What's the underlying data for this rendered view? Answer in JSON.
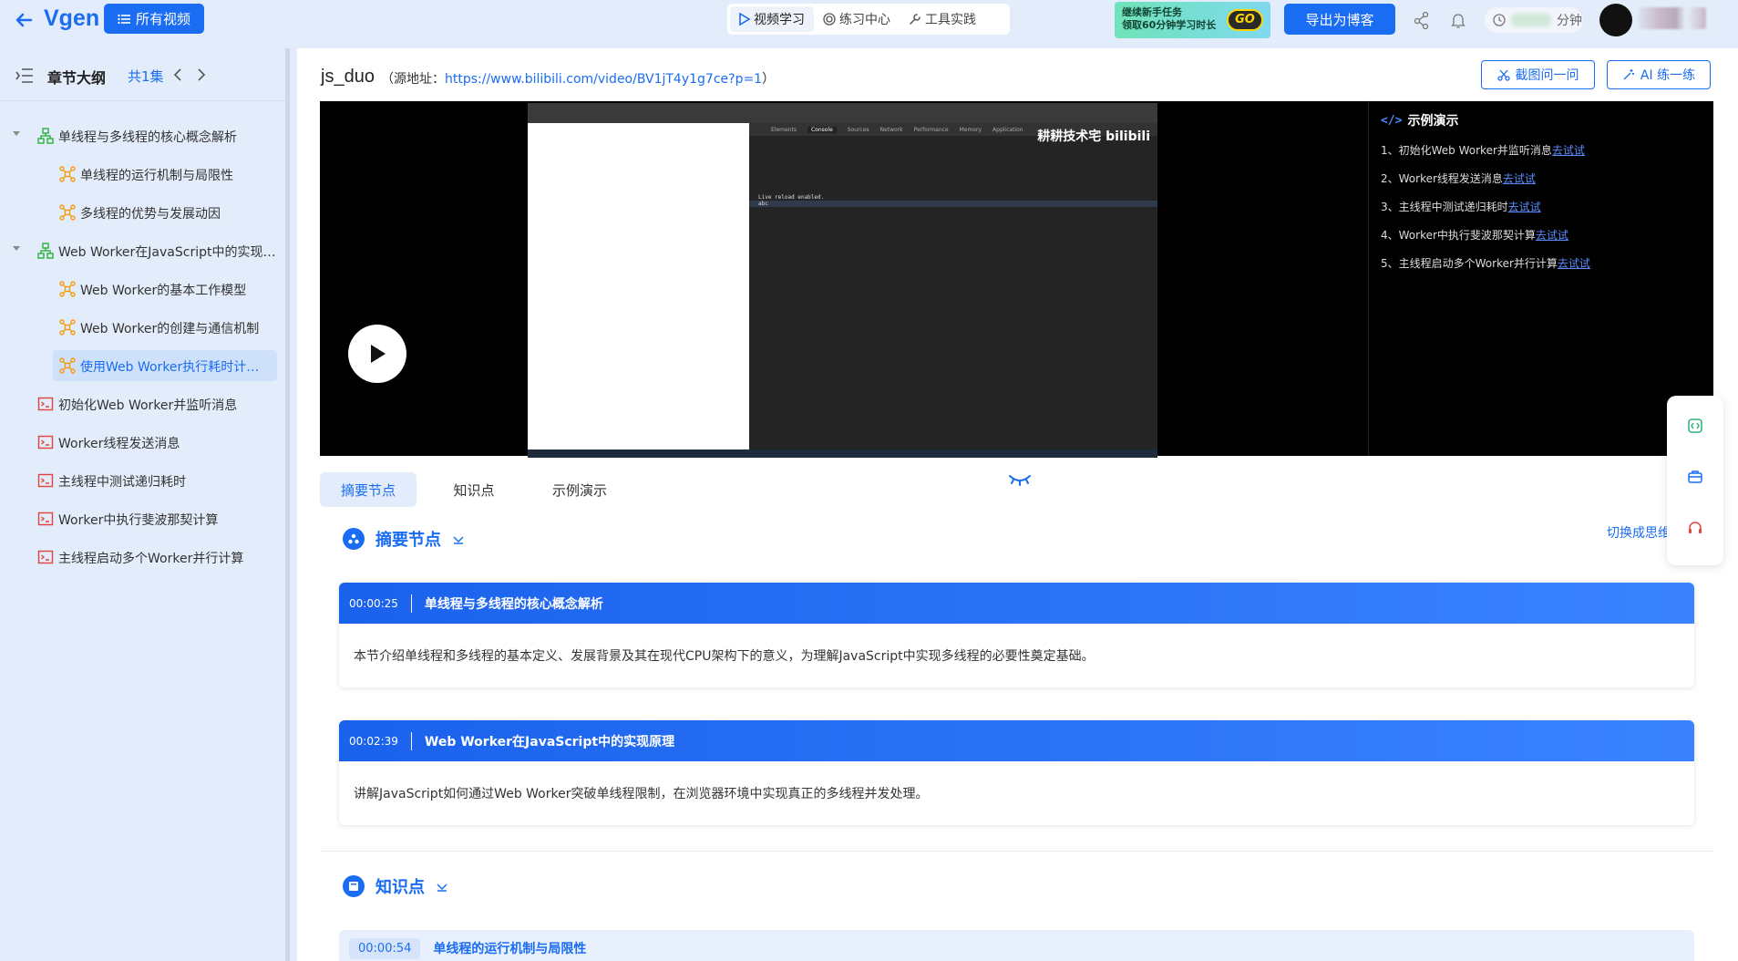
{
  "header": {
    "logo": "Vgen",
    "all_videos_label": "所有视频",
    "mode_tabs": [
      {
        "label": "视频学习",
        "icon": "play-outline-icon",
        "active": true
      },
      {
        "label": "练习中心",
        "icon": "target-icon",
        "active": false
      },
      {
        "label": "工具实践",
        "icon": "wrench-icon",
        "active": false
      }
    ],
    "promo_line1": "继续新手任务",
    "promo_line2": "领取60分钟学习时长",
    "promo_go": "GO",
    "export_label": "导出为博客",
    "timer_unit": "分钟"
  },
  "sidebar": {
    "title": "章节大纲",
    "count": "共1集",
    "items": [
      {
        "label": "单线程与多线程的核心概念解析",
        "level": 0,
        "type": "chapter",
        "expanded": true
      },
      {
        "label": "单线程的运行机制与局限性",
        "level": 1,
        "type": "point"
      },
      {
        "label": "多线程的优势与发展动因",
        "level": 1,
        "type": "point"
      },
      {
        "label": "Web Worker在JavaScript中的实现原...",
        "level": 0,
        "type": "chapter",
        "expanded": true
      },
      {
        "label": "Web Worker的基本工作模型",
        "level": 1,
        "type": "point"
      },
      {
        "label": "Web Worker的创建与通信机制",
        "level": 1,
        "type": "point"
      },
      {
        "label": "使用Web Worker执行耗时计算...",
        "level": 1,
        "type": "point",
        "active": true
      },
      {
        "label": "初始化Web Worker并监听消息",
        "level": 0,
        "type": "demo"
      },
      {
        "label": "Worker线程发送消息",
        "level": 0,
        "type": "demo"
      },
      {
        "label": "主线程中测试递归耗时",
        "level": 0,
        "type": "demo"
      },
      {
        "label": "Worker中执行斐波那契计算",
        "level": 0,
        "type": "demo"
      },
      {
        "label": "主线程启动多个Worker并行计算",
        "level": 0,
        "type": "demo"
      }
    ]
  },
  "main": {
    "title": "js_duo",
    "source_prefix": "（源地址：",
    "source_url": "https://www.bilibili.com/video/BV1jT4y1g7ce?p=1",
    "source_suffix": "）",
    "screenshot_ask_label": "截图问一问",
    "ai_practice_label": "AI 练一练",
    "player": {
      "watermark": "耕耕技术宅 bilibili",
      "devtools_tabs": [
        "Elements",
        "Console",
        "Sources",
        "Network",
        "Performance",
        "Memory",
        "Application"
      ],
      "console_lines": [
        "Live reload enabled.",
        "abc"
      ],
      "demo_title": "示例演示",
      "demo_items": [
        {
          "text": "1、初始化Web Worker并监听消息",
          "link": "去试试"
        },
        {
          "text": "2、Worker线程发送消息",
          "link": "去试试"
        },
        {
          "text": "3、主线程中测试递归耗时",
          "link": "去试试"
        },
        {
          "text": "4、Worker中执行斐波那契计算",
          "link": "去试试"
        },
        {
          "text": "5、主线程启动多个Worker并行计算",
          "link": "去试试"
        }
      ]
    },
    "tabs": [
      {
        "label": "摘要节点",
        "active": true
      },
      {
        "label": "知识点",
        "active": false
      },
      {
        "label": "示例演示",
        "active": false
      }
    ],
    "summary_section_title": "摘要节点",
    "switch_view_label": "切换成思维",
    "summary_cards": [
      {
        "time": "00:00:25",
        "title": "单线程与多线程的核心概念解析",
        "body": "本节介绍单线程和多线程的基本定义、发展背景及其在现代CPU架构下的意义，为理解JavaScript中实现多线程的必要性奠定基础。"
      },
      {
        "time": "00:02:39",
        "title": "Web Worker在JavaScript中的实现原理",
        "body": "讲解JavaScript如何通过Web Worker突破单线程限制，在浏览器环境中实现真正的多线程并发处理。"
      }
    ],
    "knowledge_section_title": "知识点",
    "knowledge_first": {
      "time": "00:00:54",
      "title": "单线程的运行机制与局限性"
    }
  },
  "colors": {
    "accent": "#1a6cf2",
    "sidebar_bg": "#e3ecfa",
    "card_head": "#1a62ec"
  }
}
